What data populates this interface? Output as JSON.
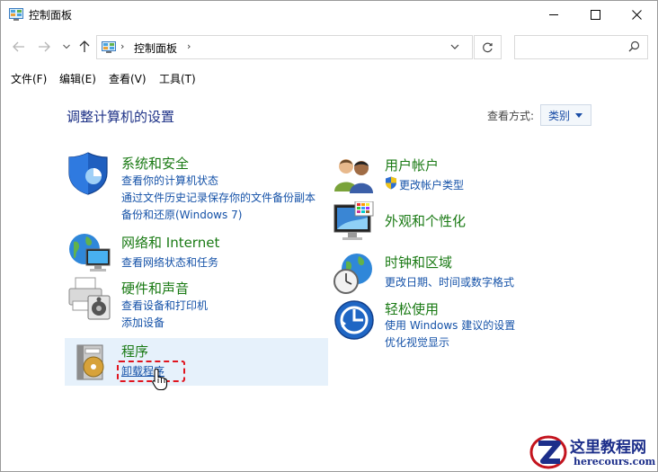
{
  "window": {
    "title": "控制面板"
  },
  "address": {
    "crumb": "控制面板",
    "search_placeholder": ""
  },
  "menu": {
    "items": [
      "文件(F)",
      "编辑(E)",
      "查看(V)",
      "工具(T)"
    ]
  },
  "content": {
    "heading": "调整计算机的设置",
    "view_by_label": "查看方式:",
    "view_by_value": "类别"
  },
  "categories": {
    "security": {
      "title": "系统和安全",
      "links": [
        "查看你的计算机状态",
        "通过文件历史记录保存你的文件备份副本",
        "备份和还原(Windows 7)"
      ]
    },
    "network": {
      "title": "网络和 Internet",
      "links": [
        "查看网络状态和任务"
      ]
    },
    "hardware": {
      "title": "硬件和声音",
      "links": [
        "查看设备和打印机",
        "添加设备"
      ]
    },
    "programs": {
      "title": "程序",
      "links": [
        "卸载程序"
      ]
    },
    "accounts": {
      "title": "用户帐户",
      "links": [
        "更改帐户类型"
      ]
    },
    "appearance": {
      "title": "外观和个性化",
      "links": []
    },
    "clock": {
      "title": "时钟和区域",
      "links": [
        "更改日期、时间或数字格式"
      ]
    },
    "ease": {
      "title": "轻松使用",
      "links": [
        "使用 Windows 建议的设置",
        "优化视觉显示"
      ]
    }
  },
  "watermark": {
    "cn": "这里教程网",
    "en": "herecours.com"
  },
  "icons": {
    "back": "back-arrow-icon",
    "forward": "forward-arrow-icon",
    "up": "up-arrow-icon",
    "refresh": "refresh-icon",
    "search": "search-icon"
  },
  "colors": {
    "category_title": "#1a7a14",
    "link": "#1552a8",
    "heading": "#1e3287",
    "highlight": "#e6f1fb",
    "annotation": "#e0141e"
  }
}
